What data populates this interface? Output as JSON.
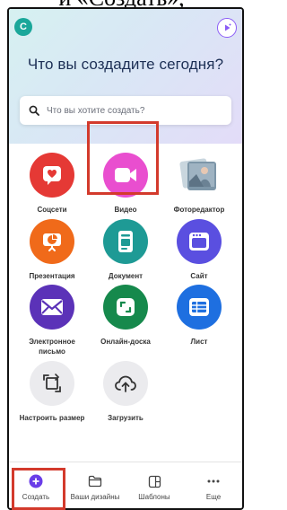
{
  "caption": "и «Создать»,",
  "header": {
    "avatar_letter": "С",
    "title": "Что вы создадите сегодня?"
  },
  "search": {
    "placeholder": "Что вы хотите создать?"
  },
  "tiles": [
    {
      "label": "Соцсети",
      "icon": "heart-icon",
      "color": "#e53935"
    },
    {
      "label": "Видео",
      "icon": "video-camera-icon",
      "color": "#e94ecf"
    },
    {
      "label": "Фоторедактор",
      "icon": "photo-stack-icon",
      "color": "#8aa2b5"
    },
    {
      "label": "Презентация",
      "icon": "presentation-chart-icon",
      "color": "#f06a1a"
    },
    {
      "label": "Документ",
      "icon": "document-icon",
      "color": "#1e9a95"
    },
    {
      "label": "Сайт",
      "icon": "website-icon",
      "color": "#5a4fe0"
    },
    {
      "label": "Электронное\nписьмо",
      "icon": "envelope-icon",
      "color": "#5b32b8"
    },
    {
      "label": "Онлайн-доска",
      "icon": "whiteboard-icon",
      "color": "#16894c"
    },
    {
      "label": "Лист",
      "icon": "sheet-icon",
      "color": "#1e6fe0"
    },
    {
      "label": "Настроить размер",
      "icon": "resize-icon",
      "color": "#ebebee"
    },
    {
      "label": "Загрузить",
      "icon": "cloud-upload-icon",
      "color": "#ebebee"
    }
  ],
  "nav": [
    {
      "label": "Создать",
      "icon": "plus-circle-icon"
    },
    {
      "label": "Ваши дизайны",
      "icon": "folder-icon"
    },
    {
      "label": "Шаблоны",
      "icon": "templates-icon"
    },
    {
      "label": "Еще",
      "icon": "more-dots-icon"
    }
  ],
  "colors": {
    "highlight": "#d33a2c",
    "accent": "#8b5cf6",
    "avatar": "#1aa79a",
    "title": "#1c2f55"
  }
}
